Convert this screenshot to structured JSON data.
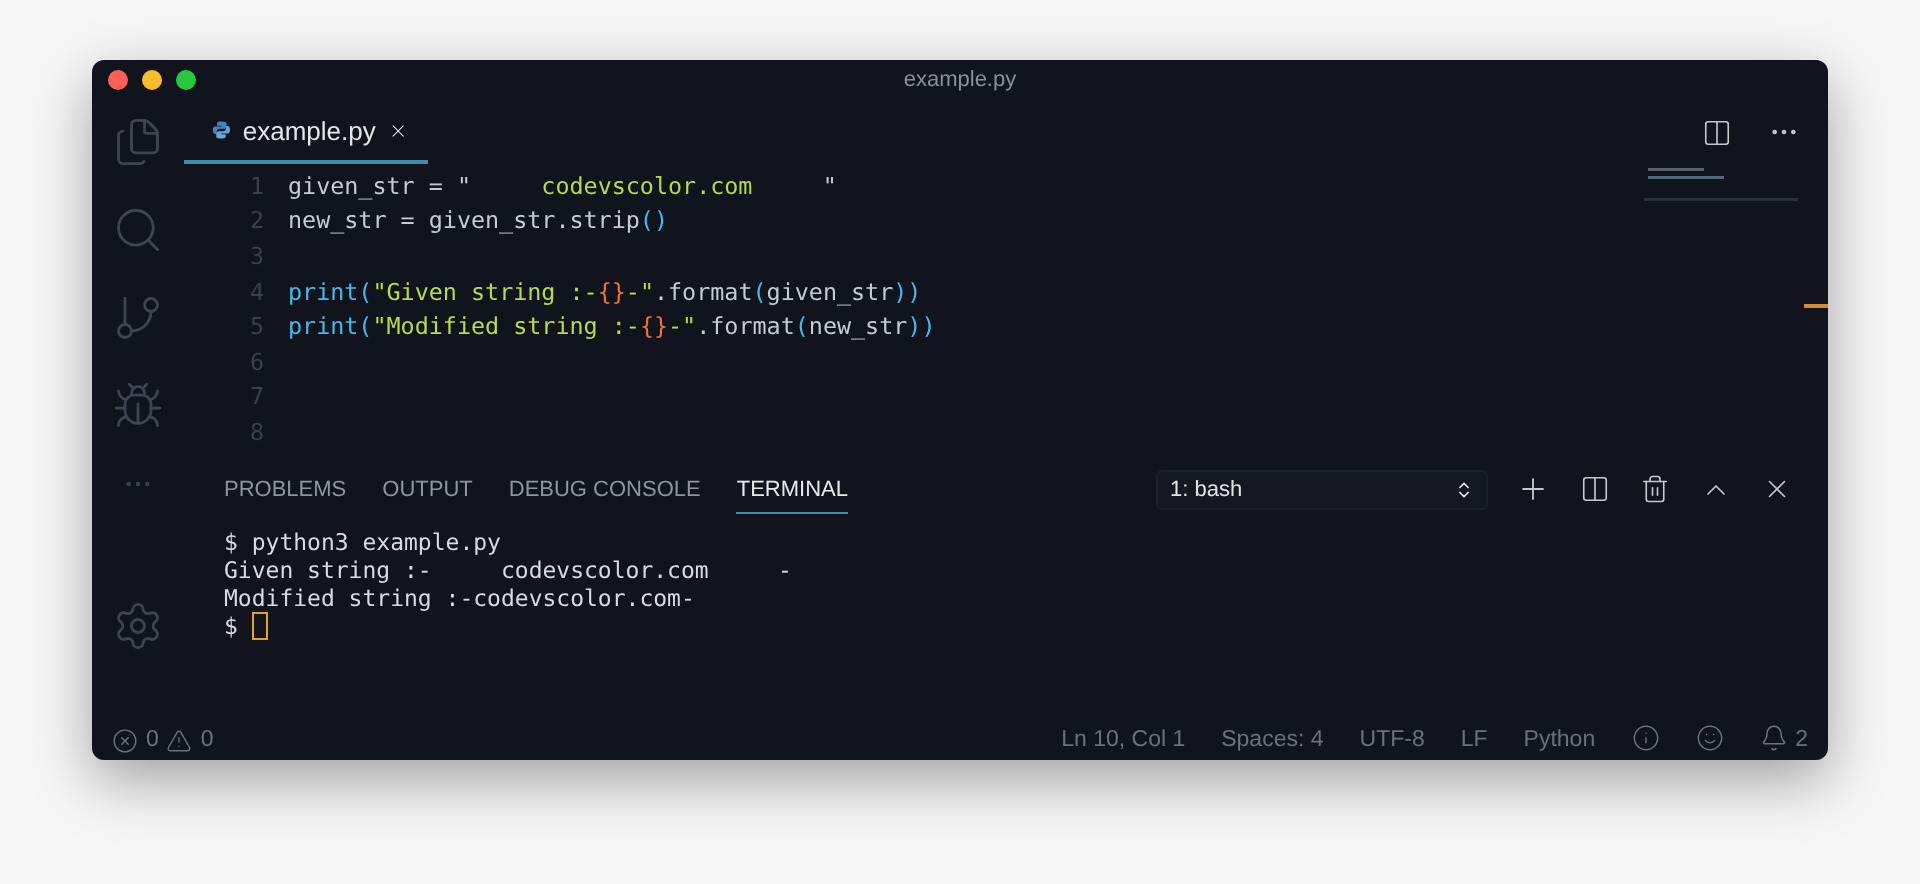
{
  "window": {
    "title": "example.py"
  },
  "activity_bar": [
    {
      "kind": "files",
      "selected": false
    },
    {
      "kind": "search",
      "selected": false
    },
    {
      "kind": "source-control",
      "selected": false
    },
    {
      "kind": "debug",
      "selected": false
    },
    {
      "kind": "more",
      "selected": false
    }
  ],
  "editor_tabs": [
    {
      "label": "example.py",
      "selected": true
    }
  ],
  "editor_lines": [
    {
      "number": "1",
      "tokens": [
        {
          "kind": "plain",
          "text": "given_str = \""
        },
        {
          "kind": "string",
          "text": "     codevscolor.com     "
        },
        {
          "kind": "plain",
          "text": "\""
        }
      ]
    },
    {
      "number": "2",
      "tokens": [
        {
          "kind": "plain",
          "text": "new_str = given_str.strip"
        },
        {
          "kind": "paren",
          "text": "()"
        }
      ]
    },
    {
      "number": "3"
    },
    {
      "number": "4",
      "tokens": [
        {
          "kind": "func",
          "text": "print("
        },
        {
          "kind": "string",
          "text": "\"Given string :-"
        },
        {
          "kind": "brace",
          "text": "{}"
        },
        {
          "kind": "string",
          "text": "-\""
        },
        {
          "kind": "plain",
          "text": ".format"
        },
        {
          "kind": "paren",
          "text": "("
        },
        {
          "kind": "plain",
          "text": "given_str"
        },
        {
          "kind": "paren",
          "text": "))"
        }
      ]
    },
    {
      "number": "5",
      "tokens": [
        {
          "kind": "func",
          "text": "print("
        },
        {
          "kind": "string",
          "text": "\"Modified string :-"
        },
        {
          "kind": "brace",
          "text": "{}"
        },
        {
          "kind": "string",
          "text": "-\""
        },
        {
          "kind": "plain",
          "text": ".format"
        },
        {
          "kind": "paren",
          "text": "("
        },
        {
          "kind": "plain",
          "text": "new_str"
        },
        {
          "kind": "paren",
          "text": "))"
        }
      ]
    },
    {
      "number": "6"
    },
    {
      "number": "7"
    },
    {
      "number": "8"
    }
  ],
  "panel_tabs": [
    {
      "label": "PROBLEMS",
      "selected": false
    },
    {
      "label": "OUTPUT",
      "selected": false
    },
    {
      "label": "DEBUG CONSOLE",
      "selected": false
    },
    {
      "label": "TERMINAL",
      "selected": true
    }
  ],
  "terminal_select": {
    "value": "1: bash"
  },
  "terminal_lines": [
    "$ python3 example.py",
    "Given string :-     codevscolor.com     -",
    "Modified string :-codevscolor.com-",
    "$ "
  ],
  "status_bar": {
    "errors": "0",
    "warnings": "0",
    "items": [
      "Ln 10, Col 1",
      "Spaces: 4",
      "UTF-8",
      "LF",
      "Python"
    ],
    "notifications": "2"
  }
}
